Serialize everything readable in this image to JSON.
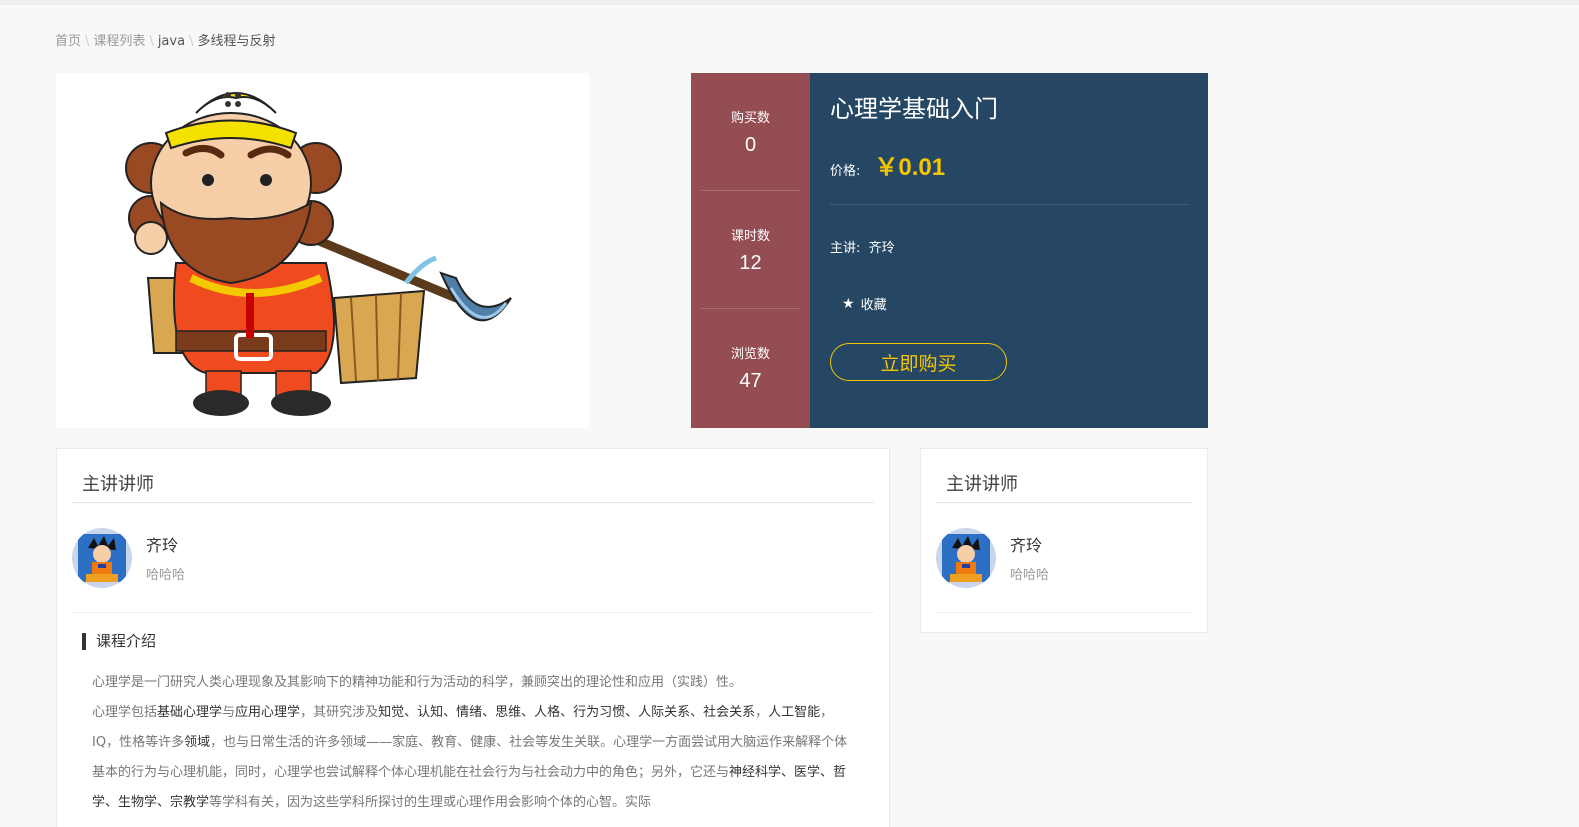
{
  "breadcrumb": {
    "home": "首页",
    "list": "课程列表",
    "category": "java",
    "current": "多线程与反射",
    "separator": "\\"
  },
  "stats": {
    "purchases_label": "购买数",
    "purchases": "0",
    "lessons_label": "课时数",
    "lessons": "12",
    "views_label": "浏览数",
    "views": "47"
  },
  "course": {
    "title": "心理学基础入门",
    "price_label": "价格:",
    "price": "￥0.01",
    "teacher_label": "主讲:",
    "teacher_name": "齐玲",
    "favorite_label": "收藏",
    "buy_label": "立即购买"
  },
  "teacher_panel_left": {
    "heading": "主讲讲师",
    "name": "齐玲",
    "desc": "哈哈哈"
  },
  "teacher_panel_right": {
    "heading": "主讲讲师",
    "name": "齐玲",
    "desc": "哈哈哈"
  },
  "intro": {
    "heading": "课程介绍",
    "p1": "心理学是一门研究人类心理现象及其影响下的精神功能和行为活动的科学，兼顾突出的理论性和应用（实践）性。",
    "p2_a": "心理学包括",
    "p2_b": "基础心理学",
    "p2_c": "与",
    "p2_d": "应用心理学",
    "p2_e": "，其研究涉及",
    "p2_f": "知觉、认知、情绪、思维、人格、行为习惯、人际关系、社会关系",
    "p2_g": "，",
    "p2_h": "人工智能",
    "p2_i": "，IQ，性格等许多",
    "p2_j": "领域",
    "p2_k": "，也与日常生活的许多领域——家庭、教育、健康、社会等发生关联。心理学一方面尝试用大脑运作来解释个体基本的行为与心理机能，同时，心理学也尝试解释个体心理机能在社会行为与社会动力中的角色；另外，它还与",
    "p2_l": "神经科学、医学、哲学、生物学、宗教学",
    "p2_m": "等学科有关，因为这些学科所探讨的生理或心理作用会影响个体的心智。实际"
  },
  "colors": {
    "stats_bg": "#944e53",
    "info_bg": "#264763",
    "price": "#f4c400"
  }
}
